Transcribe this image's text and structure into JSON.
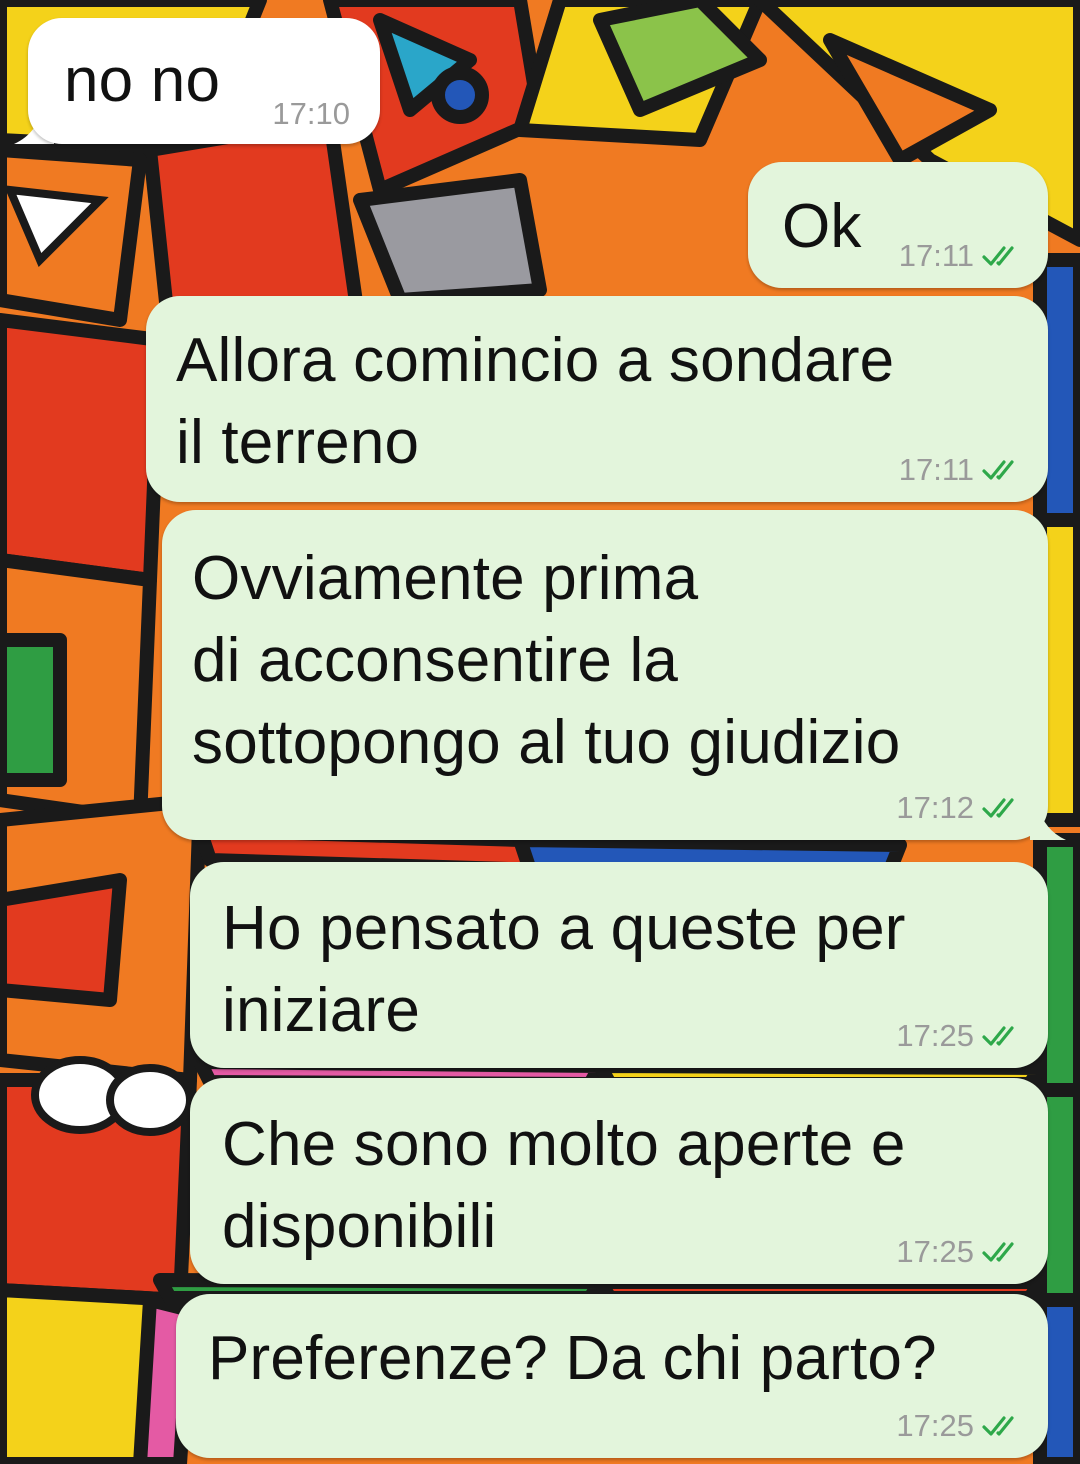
{
  "chat": {
    "accent_read": "#2ea84a",
    "messages": [
      {
        "direction": "incoming",
        "text": "no no",
        "time": "17:10"
      },
      {
        "direction": "outgoing",
        "text": "Ok",
        "time": "17:11",
        "status": "read"
      },
      {
        "direction": "outgoing",
        "text": "Allora comincio a sondare\nil terreno",
        "time": "17:11",
        "status": "read"
      },
      {
        "direction": "outgoing",
        "text": "Ovviamente prima\ndi acconsentire la\nsottopongo al tuo giudizio",
        "time": "17:12",
        "status": "read"
      },
      {
        "direction": "outgoing",
        "text": "Ho pensato a queste per\niniziare",
        "time": "17:25",
        "status": "read"
      },
      {
        "direction": "outgoing",
        "text": "Che sono molto aperte e\ndisponibili",
        "time": "17:25",
        "status": "read"
      },
      {
        "direction": "outgoing",
        "text": "Preferenze? Da chi parto?",
        "time": "17:25",
        "status": "read"
      }
    ]
  },
  "icons": {
    "read_status": "double-check-icon"
  },
  "wallpaper": {
    "colors": [
      "#f07a22",
      "#e23a1f",
      "#f4d21a",
      "#2f9d43",
      "#2357b8",
      "#9a9aa0",
      "#e45aa4"
    ]
  }
}
